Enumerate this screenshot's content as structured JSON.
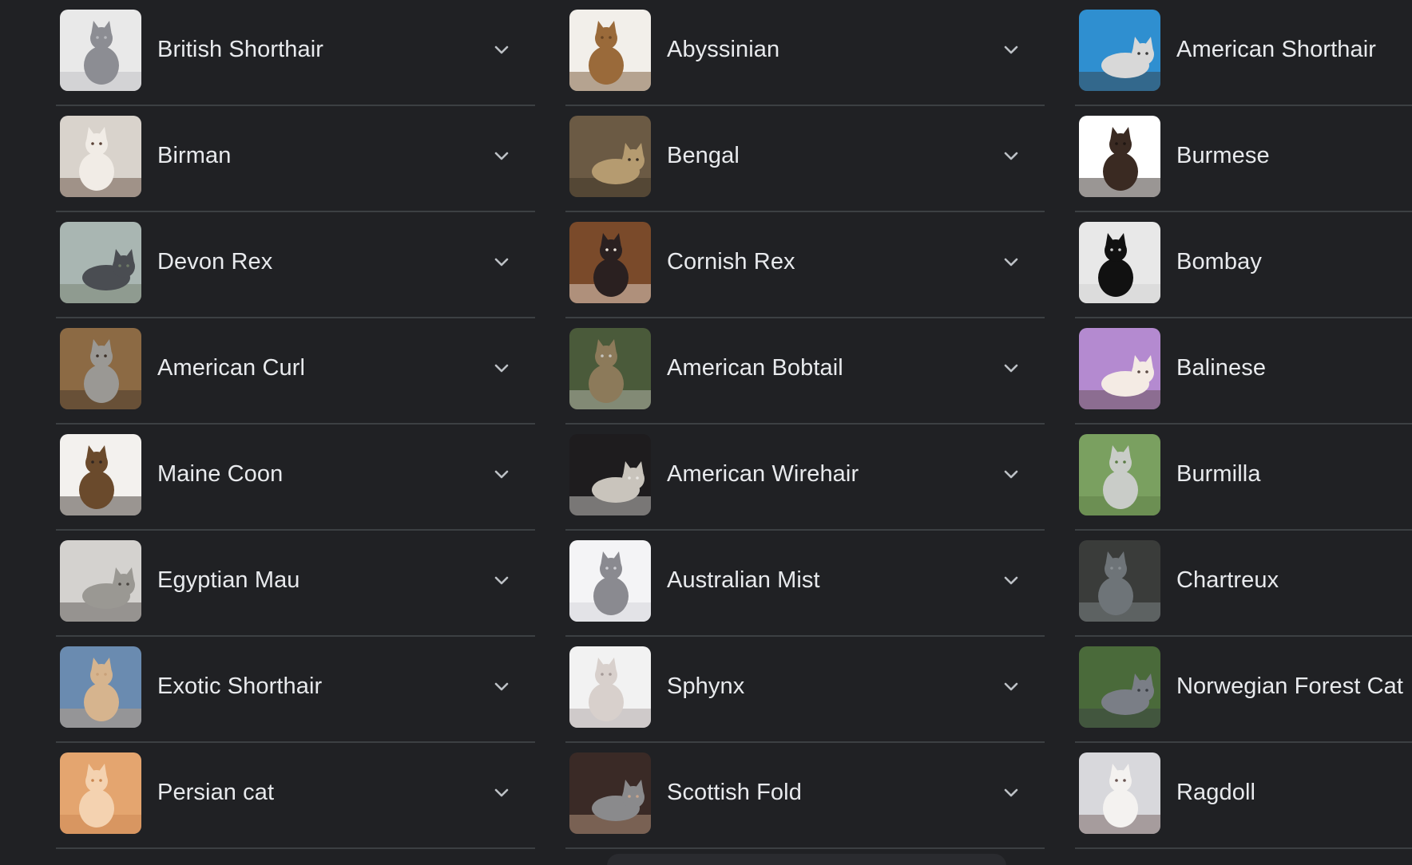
{
  "columns": [
    {
      "items": [
        {
          "label": "British Shorthair",
          "icon": "cat-thumbnail",
          "colors": [
            "#e9e9e9",
            "#8c8d93",
            "#b7b8bd"
          ]
        },
        {
          "label": "Birman",
          "icon": "cat-thumbnail",
          "colors": [
            "#d9d3cc",
            "#f1ece6",
            "#5a4236"
          ]
        },
        {
          "label": "Devon Rex",
          "icon": "cat-thumbnail",
          "colors": [
            "#a9b6b2",
            "#4a4d52",
            "#6e7a66"
          ]
        },
        {
          "label": "American Curl",
          "icon": "cat-thumbnail",
          "colors": [
            "#8c6a44",
            "#9a9894",
            "#3b3028"
          ]
        },
        {
          "label": "Maine Coon",
          "icon": "cat-thumbnail",
          "colors": [
            "#f3f1ee",
            "#6a4a2c",
            "#2f2520"
          ]
        },
        {
          "label": "Egyptian Mau",
          "icon": "cat-thumbnail",
          "colors": [
            "#d4d2cf",
            "#9a9893",
            "#4b4743"
          ]
        },
        {
          "label": "Exotic Shorthair",
          "icon": "cat-thumbnail",
          "colors": [
            "#6a8bb0",
            "#d6b48e",
            "#c9a27a"
          ]
        },
        {
          "label": "Persian cat",
          "icon": "cat-thumbnail",
          "colors": [
            "#e4a56f",
            "#f4d2b0",
            "#c98650"
          ]
        }
      ]
    },
    {
      "items": [
        {
          "label": "Abyssinian",
          "icon": "cat-thumbnail",
          "colors": [
            "#f2efea",
            "#9a6a3a",
            "#6a4624"
          ]
        },
        {
          "label": "Bengal",
          "icon": "cat-thumbnail",
          "colors": [
            "#6b5a44",
            "#b59b70",
            "#3a3024"
          ]
        },
        {
          "label": "Cornish Rex",
          "icon": "cat-thumbnail",
          "colors": [
            "#7a4a2a",
            "#2a2020",
            "#efe7de"
          ]
        },
        {
          "label": "American Bobtail",
          "icon": "cat-thumbnail",
          "colors": [
            "#4a5a3a",
            "#8c7a5a",
            "#c7c5bf"
          ]
        },
        {
          "label": "American Wirehair",
          "icon": "cat-thumbnail",
          "colors": [
            "#1e1c1e",
            "#c9c4bc",
            "#e8e6e2"
          ]
        },
        {
          "label": "Australian Mist",
          "icon": "cat-thumbnail",
          "colors": [
            "#f4f4f6",
            "#8a8a90",
            "#cfcfd4"
          ]
        },
        {
          "label": "Sphynx",
          "icon": "cat-thumbnail",
          "colors": [
            "#f2f2f2",
            "#d8d0cc",
            "#a59a98"
          ]
        },
        {
          "label": "Scottish Fold",
          "icon": "cat-thumbnail",
          "colors": [
            "#3a2a26",
            "#8a8a8c",
            "#c7a48c"
          ]
        }
      ]
    },
    {
      "items": [
        {
          "label": "American Shorthair",
          "icon": "cat-thumbnail",
          "colors": [
            "#2f8fd0",
            "#d8d8d8",
            "#3a3a3a"
          ]
        },
        {
          "label": "Burmese",
          "icon": "cat-thumbnail",
          "colors": [
            "#ffffff",
            "#3a2a22",
            "#1e1612"
          ]
        },
        {
          "label": "Bombay",
          "icon": "cat-thumbnail",
          "colors": [
            "#e8e8e8",
            "#111111",
            "#cfcfcf"
          ]
        },
        {
          "label": "Balinese",
          "icon": "cat-thumbnail",
          "colors": [
            "#b48ad0",
            "#f4ebe4",
            "#5a4a44"
          ]
        },
        {
          "label": "Burmilla",
          "icon": "cat-thumbnail",
          "colors": [
            "#7aa060",
            "#c9ccc8",
            "#5a7a44"
          ]
        },
        {
          "label": "Chartreux",
          "icon": "cat-thumbnail",
          "colors": [
            "#3a3c3a",
            "#6e7478",
            "#8a9094"
          ]
        },
        {
          "label": "Norwegian Forest Cat",
          "icon": "cat-thumbnail",
          "colors": [
            "#4a6a3a",
            "#7a7e86",
            "#3a3e44"
          ]
        },
        {
          "label": "Ragdoll",
          "icon": "cat-thumbnail",
          "colors": [
            "#d8d8dc",
            "#f4f2f0",
            "#6a5450"
          ]
        }
      ]
    }
  ],
  "expand_icon": "chevron-down-icon",
  "text_color": "#e8eaed",
  "background": "#202124",
  "divider_color": "#3c4043"
}
